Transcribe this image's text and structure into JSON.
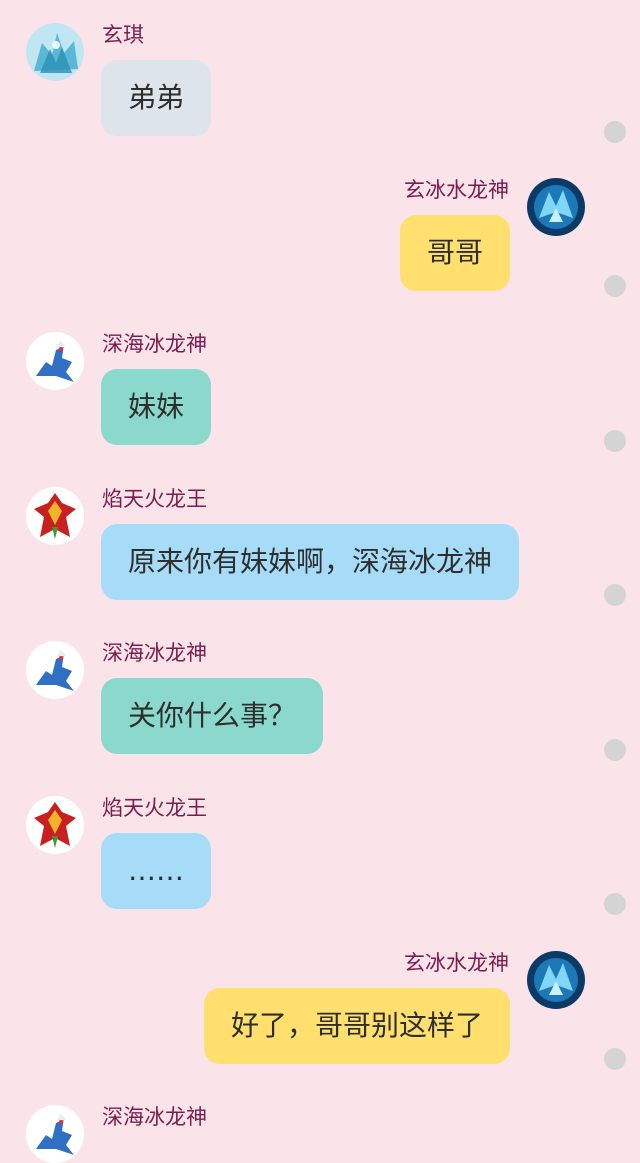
{
  "messages": [
    {
      "sender": "玄琪",
      "text": "弟弟",
      "side": "left",
      "bubble_color": "#dde4ec",
      "avatar_icon": "blue-ice-creature-avatar"
    },
    {
      "sender": "玄冰水龙神",
      "text": "哥哥",
      "side": "right",
      "bubble_color": "#ffdf6e",
      "avatar_icon": "ice-water-dragon-avatar"
    },
    {
      "sender": "深海冰龙神",
      "text": "妹妹",
      "side": "left",
      "bubble_color": "#8bd9cd",
      "avatar_icon": "deep-sea-ice-dragon-avatar"
    },
    {
      "sender": "焰天火龙王",
      "text": "原来你有妹妹啊，深海冰龙神",
      "side": "left",
      "bubble_color": "#a7dcf8",
      "avatar_icon": "flame-fire-dragon-avatar"
    },
    {
      "sender": "深海冰龙神",
      "text": "关你什么事？",
      "side": "left",
      "bubble_color": "#8bd9cd",
      "avatar_icon": "deep-sea-ice-dragon-avatar"
    },
    {
      "sender": "焰天火龙王",
      "text": "……",
      "side": "left",
      "bubble_color": "#a7dcf8",
      "avatar_icon": "flame-fire-dragon-avatar"
    },
    {
      "sender": "玄冰水龙神",
      "text": "好了，哥哥别这样了",
      "side": "right",
      "bubble_color": "#ffdf6e",
      "avatar_icon": "ice-water-dragon-avatar"
    },
    {
      "sender": "深海冰龙神",
      "text": "",
      "side": "left",
      "bubble_color": "#8bd9cd",
      "avatar_icon": "deep-sea-ice-dragon-avatar"
    }
  ],
  "colors": {
    "background": "#fbe3ea",
    "sender_name": "#7a1d4c",
    "read_dot": "#d4d4d4"
  }
}
